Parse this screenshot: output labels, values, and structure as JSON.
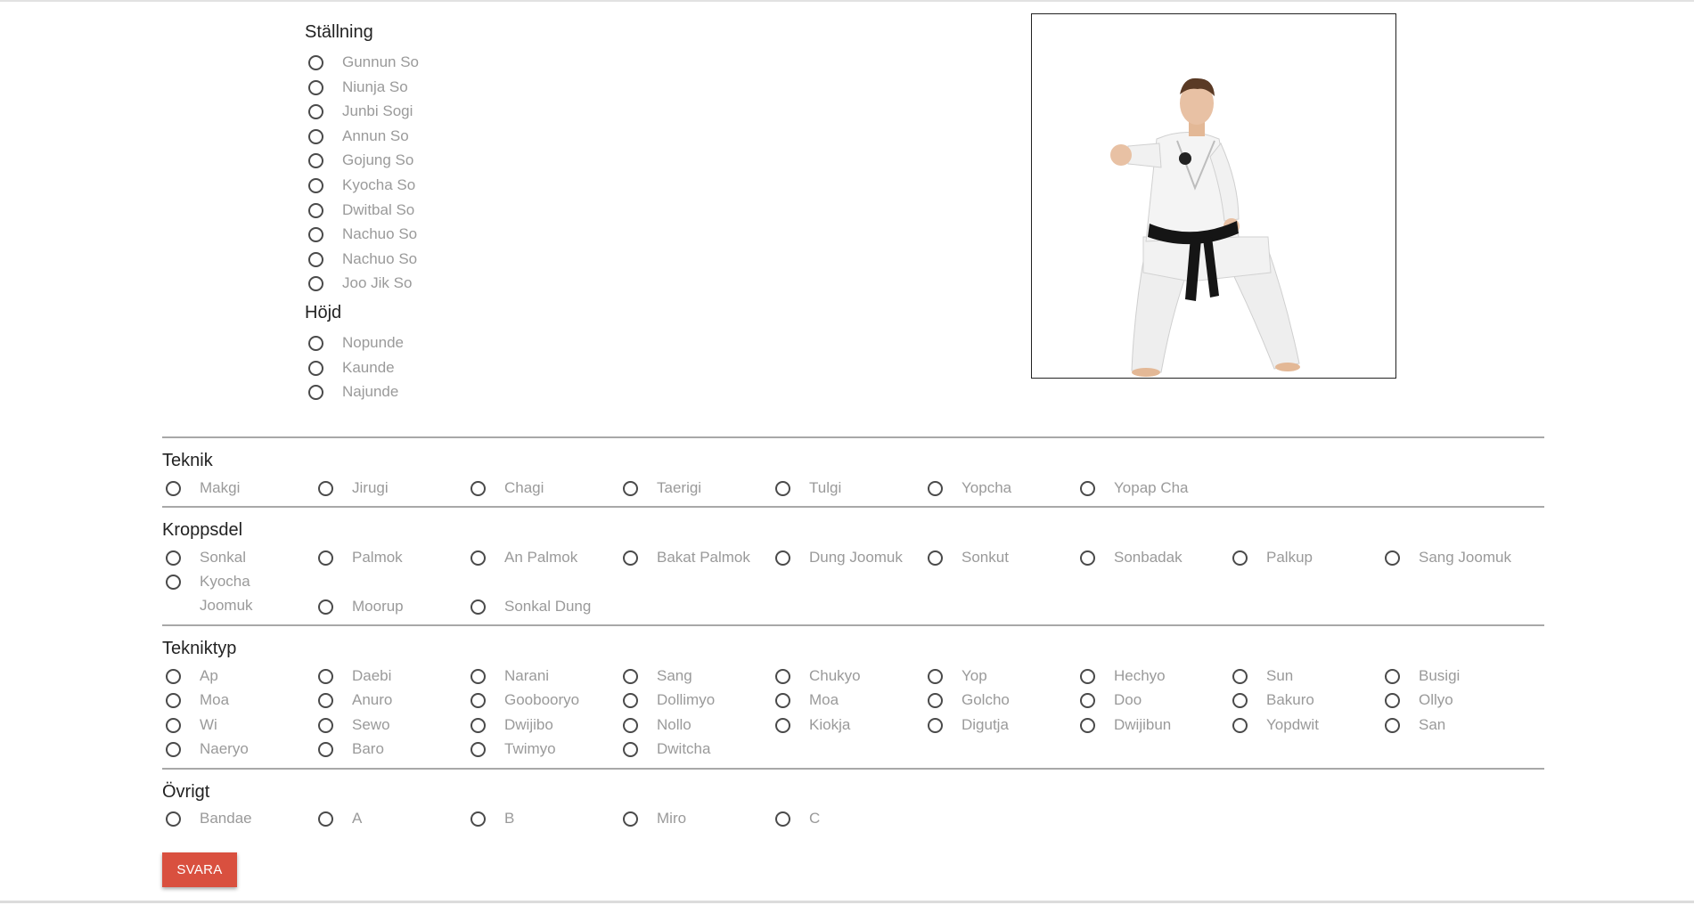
{
  "stallning": {
    "title": "Ställning",
    "options": [
      "Gunnun So",
      "Niunja So",
      "Junbi Sogi",
      "Annun So",
      "Gojung So",
      "Kyocha So",
      "Dwitbal So",
      "Nachuo So",
      "Nachuo So",
      "Joo Jik So"
    ]
  },
  "hojd": {
    "title": "Höjd",
    "options": [
      "Nopunde",
      "Kaunde",
      "Najunde"
    ]
  },
  "teknik": {
    "title": "Teknik",
    "options": [
      "Makgi",
      "Jirugi",
      "Chagi",
      "Taerigi",
      "Tulgi",
      "Yopcha",
      "Yopap Cha"
    ]
  },
  "kroppsdel": {
    "title": "Kroppsdel",
    "options": [
      "Sonkal",
      "Palmok",
      "An Palmok",
      "Bakat Palmok",
      "Dung Joomuk",
      "Sonkut",
      "Sonbadak",
      "Palkup",
      "Sang Joomuk",
      "Kyocha Joomuk",
      "Moorup",
      "Sonkal Dung"
    ]
  },
  "tekniktyp": {
    "title": "Tekniktyp",
    "options": [
      "Ap",
      "Daebi",
      "Narani",
      "Sang",
      "Chukyo",
      "Yop",
      "Hechyo",
      "Sun",
      "Busigi",
      "Moa",
      "Anuro",
      "Goobooryo",
      "Dollimyo",
      "Moa",
      "Golcho",
      "Doo",
      "Bakuro",
      "Ollyo",
      "Wi",
      "Sewo",
      "Dwijibo",
      "Nollo",
      "Kiokja",
      "Digutja",
      "Dwijibun",
      "Yopdwit",
      "San",
      "Naeryo",
      "Baro",
      "Twimyo",
      "Dwitcha"
    ]
  },
  "ovrigt": {
    "title": "Övrigt",
    "options": [
      "Bandae",
      "A",
      "B",
      "Miro",
      "C"
    ]
  },
  "submit": {
    "label": "SVARA"
  },
  "colors": {
    "button": "#d9503f",
    "label": "#9a9a9a",
    "radio": "#4a4a4a"
  }
}
